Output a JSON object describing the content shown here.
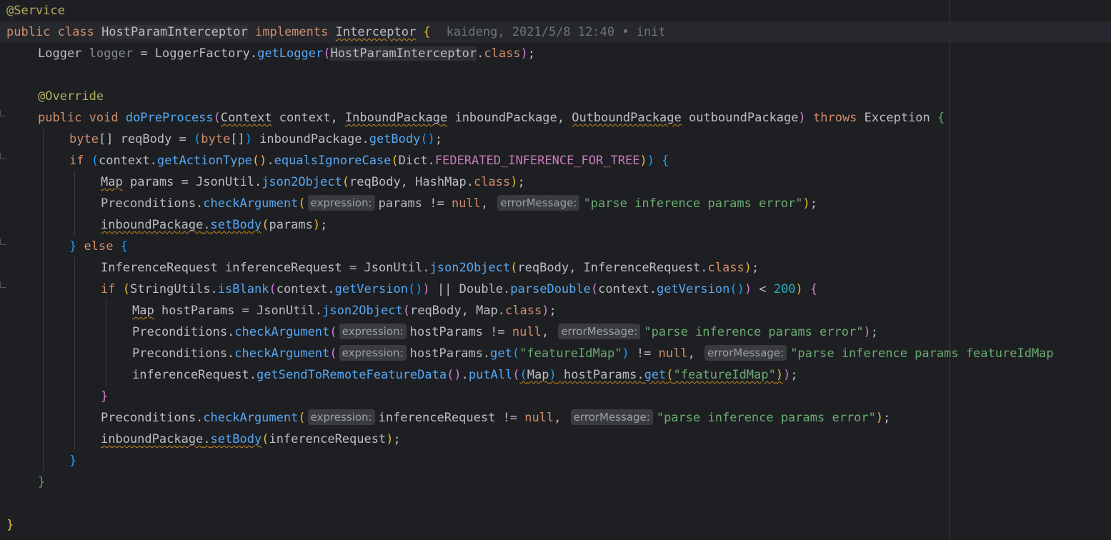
{
  "editor": {
    "lines": [
      {
        "tokens": [
          {
            "t": "@Service",
            "c": "ann"
          }
        ]
      },
      {
        "current": true,
        "tokens": [
          {
            "t": "public class ",
            "c": "kw"
          },
          {
            "t": "HostParamInterceptor",
            "c": "cls hl"
          },
          {
            "t": " implements ",
            "c": "kw"
          },
          {
            "t": "Interceptor",
            "c": "cls squig"
          },
          {
            "t": " {",
            "c": "yellow"
          }
        ],
        "blame": "kaideng, 2021/5/8 12:40 • init"
      },
      {
        "indent": 1,
        "tokens": [
          {
            "t": "Logger ",
            "c": "cls"
          },
          {
            "t": "logger",
            "c": "dim"
          },
          {
            "t": " = LoggerFactory.",
            "c": "cls"
          },
          {
            "t": "getLogger",
            "c": "fn"
          },
          {
            "t": "(",
            "c": "magenta"
          },
          {
            "t": "HostParamInterceptor",
            "c": "cls hl"
          },
          {
            "t": ".",
            "c": "cls"
          },
          {
            "t": "class",
            "c": "kw"
          },
          {
            "t": ")",
            "c": "magenta"
          },
          {
            "t": ";",
            "c": "cls"
          }
        ]
      },
      {
        "tokens": []
      },
      {
        "indent": 1,
        "tokens": [
          {
            "t": "@Override",
            "c": "ann"
          }
        ]
      },
      {
        "indent": 1,
        "fold": true,
        "tokens": [
          {
            "t": "public void ",
            "c": "kw"
          },
          {
            "t": "doPreProcess",
            "c": "fn"
          },
          {
            "t": "(",
            "c": "magenta"
          },
          {
            "t": "Context",
            "c": "cls squig"
          },
          {
            "t": " context, ",
            "c": "cls"
          },
          {
            "t": "InboundPackage",
            "c": "cls squig"
          },
          {
            "t": " inboundPackage, ",
            "c": "cls"
          },
          {
            "t": "OutboundPackage",
            "c": "cls squig"
          },
          {
            "t": " outboundPackage",
            "c": "cls"
          },
          {
            "t": ")",
            "c": "magenta"
          },
          {
            "t": " throws ",
            "c": "kw"
          },
          {
            "t": "Exception ",
            "c": "cls"
          },
          {
            "t": "{",
            "c": "green2"
          }
        ]
      },
      {
        "indent": 2,
        "tokens": [
          {
            "t": "byte",
            "c": "kw"
          },
          {
            "t": "[] reqBody = ",
            "c": "cls"
          },
          {
            "t": "(",
            "c": "blue2"
          },
          {
            "t": "byte",
            "c": "kw"
          },
          {
            "t": "[]",
            "c": "cls"
          },
          {
            "t": ")",
            "c": "blue2"
          },
          {
            "t": " inboundPackage.",
            "c": "cls"
          },
          {
            "t": "getBody",
            "c": "fn"
          },
          {
            "t": "()",
            "c": "blue2"
          },
          {
            "t": ";",
            "c": "cls"
          }
        ]
      },
      {
        "indent": 2,
        "fold": true,
        "tokens": [
          {
            "t": "if ",
            "c": "kw"
          },
          {
            "t": "(",
            "c": "blue2"
          },
          {
            "t": "context.",
            "c": "cls"
          },
          {
            "t": "getActionType",
            "c": "fn"
          },
          {
            "t": "()",
            "c": "yellow"
          },
          {
            "t": ".",
            "c": "cls"
          },
          {
            "t": "equalsIgnoreCase",
            "c": "fn"
          },
          {
            "t": "(",
            "c": "yellow"
          },
          {
            "t": "Dict.",
            "c": "cls"
          },
          {
            "t": "FEDERATED_INFERENCE_FOR_TREE",
            "c": "const"
          },
          {
            "t": ")",
            "c": "yellow"
          },
          {
            "t": ")",
            "c": "blue2"
          },
          {
            "t": " {",
            "c": "blue2"
          }
        ]
      },
      {
        "indent": 3,
        "tokens": [
          {
            "t": "Map",
            "c": "cls squig"
          },
          {
            "t": " params = JsonUtil.",
            "c": "cls"
          },
          {
            "t": "json2Object",
            "c": "fn"
          },
          {
            "t": "(",
            "c": "yellow"
          },
          {
            "t": "reqBody, HashMap.",
            "c": "cls"
          },
          {
            "t": "class",
            "c": "kw"
          },
          {
            "t": ")",
            "c": "yellow"
          },
          {
            "t": ";",
            "c": "cls"
          }
        ]
      },
      {
        "indent": 3,
        "tokens": [
          {
            "t": "Preconditions.",
            "c": "cls"
          },
          {
            "t": "checkArgument",
            "c": "fn"
          },
          {
            "t": "(",
            "c": "yellow"
          },
          {
            "hint": "expression:"
          },
          {
            "t": "params != ",
            "c": "cls"
          },
          {
            "t": "null",
            "c": "kw"
          },
          {
            "t": ", ",
            "c": "cls"
          },
          {
            "hint": "errorMessage:"
          },
          {
            "t": "\"parse inference params error\"",
            "c": "str"
          },
          {
            "t": ")",
            "c": "yellow"
          },
          {
            "t": ";",
            "c": "cls"
          }
        ]
      },
      {
        "indent": 3,
        "tokens": [
          {
            "t": "inboundPackage",
            "c": "cls squig"
          },
          {
            "t": ".",
            "c": "cls squig"
          },
          {
            "t": "setBody",
            "c": "fn squig"
          },
          {
            "t": "(",
            "c": "yellow"
          },
          {
            "t": "params",
            "c": "cls"
          },
          {
            "t": ")",
            "c": "yellow"
          },
          {
            "t": ";",
            "c": "cls"
          }
        ]
      },
      {
        "indent": 2,
        "fold": true,
        "tokens": [
          {
            "t": "}",
            "c": "blue2"
          },
          {
            "t": " else ",
            "c": "kw"
          },
          {
            "t": "{",
            "c": "blue2"
          }
        ]
      },
      {
        "indent": 3,
        "tokens": [
          {
            "t": "InferenceRequest inferenceRequest = JsonUtil.",
            "c": "cls"
          },
          {
            "t": "json2Object",
            "c": "fn"
          },
          {
            "t": "(",
            "c": "yellow"
          },
          {
            "t": "reqBody, InferenceRequest.",
            "c": "cls"
          },
          {
            "t": "class",
            "c": "kw"
          },
          {
            "t": ")",
            "c": "yellow"
          },
          {
            "t": ";",
            "c": "cls"
          }
        ]
      },
      {
        "indent": 3,
        "fold": true,
        "tokens": [
          {
            "t": "if ",
            "c": "kw"
          },
          {
            "t": "(",
            "c": "yellow"
          },
          {
            "t": "StringUtils.",
            "c": "cls"
          },
          {
            "t": "isBlank",
            "c": "fn"
          },
          {
            "t": "(",
            "c": "magenta"
          },
          {
            "t": "context.",
            "c": "cls"
          },
          {
            "t": "getVersion",
            "c": "fn"
          },
          {
            "t": "()",
            "c": "blue2"
          },
          {
            "t": ")",
            "c": "magenta"
          },
          {
            "t": " || Double.",
            "c": "cls"
          },
          {
            "t": "parseDouble",
            "c": "fn"
          },
          {
            "t": "(",
            "c": "magenta"
          },
          {
            "t": "context.",
            "c": "cls"
          },
          {
            "t": "getVersion",
            "c": "fn"
          },
          {
            "t": "()",
            "c": "blue2"
          },
          {
            "t": ")",
            "c": "magenta"
          },
          {
            "t": " < ",
            "c": "cls"
          },
          {
            "t": "200",
            "c": "num"
          },
          {
            "t": ")",
            "c": "yellow"
          },
          {
            "t": " {",
            "c": "magenta"
          }
        ]
      },
      {
        "indent": 4,
        "tokens": [
          {
            "t": "Map",
            "c": "cls squig"
          },
          {
            "t": " hostParams = JsonUtil.",
            "c": "cls"
          },
          {
            "t": "json2Object",
            "c": "fn"
          },
          {
            "t": "(",
            "c": "magenta"
          },
          {
            "t": "reqBody, Map.",
            "c": "cls"
          },
          {
            "t": "class",
            "c": "kw"
          },
          {
            "t": ")",
            "c": "magenta"
          },
          {
            "t": ";",
            "c": "cls"
          }
        ]
      },
      {
        "indent": 4,
        "tokens": [
          {
            "t": "Preconditions.",
            "c": "cls"
          },
          {
            "t": "checkArgument",
            "c": "fn"
          },
          {
            "t": "(",
            "c": "magenta"
          },
          {
            "hint": "expression:"
          },
          {
            "t": "hostParams != ",
            "c": "cls"
          },
          {
            "t": "null",
            "c": "kw"
          },
          {
            "t": ", ",
            "c": "cls"
          },
          {
            "hint": "errorMessage:"
          },
          {
            "t": "\"parse inference params error\"",
            "c": "str"
          },
          {
            "t": ")",
            "c": "magenta"
          },
          {
            "t": ";",
            "c": "cls"
          }
        ]
      },
      {
        "indent": 4,
        "tokens": [
          {
            "t": "Preconditions.",
            "c": "cls"
          },
          {
            "t": "checkArgument",
            "c": "fn"
          },
          {
            "t": "(",
            "c": "magenta"
          },
          {
            "hint": "expression:"
          },
          {
            "t": "hostParams.",
            "c": "cls"
          },
          {
            "t": "get",
            "c": "fn"
          },
          {
            "t": "(",
            "c": "blue2"
          },
          {
            "t": "\"featureIdMap\"",
            "c": "str"
          },
          {
            "t": ")",
            "c": "blue2"
          },
          {
            "t": " != ",
            "c": "cls"
          },
          {
            "t": "null",
            "c": "kw"
          },
          {
            "t": ", ",
            "c": "cls"
          },
          {
            "hint": "errorMessage:"
          },
          {
            "t": "\"parse inference params featureIdMap",
            "c": "str"
          }
        ]
      },
      {
        "indent": 4,
        "tokens": [
          {
            "t": "inferenceRequest.",
            "c": "cls"
          },
          {
            "t": "getSendToRemoteFeatureData",
            "c": "fn"
          },
          {
            "t": "()",
            "c": "magenta"
          },
          {
            "t": ".",
            "c": "cls"
          },
          {
            "t": "putAll",
            "c": "fn"
          },
          {
            "t": "(",
            "c": "magenta"
          },
          {
            "t": "(",
            "c": "blue2 squig"
          },
          {
            "t": "Map",
            "c": "cls squig"
          },
          {
            "t": ")",
            "c": "blue2 squig"
          },
          {
            "t": " hostParams.",
            "c": "cls squig"
          },
          {
            "t": "get",
            "c": "fn squig"
          },
          {
            "t": "(",
            "c": "yellow squig"
          },
          {
            "t": "\"featureIdMap\"",
            "c": "str squig"
          },
          {
            "t": ")",
            "c": "yellow squig"
          },
          {
            "t": ")",
            "c": "magenta"
          },
          {
            "t": ";",
            "c": "cls"
          }
        ]
      },
      {
        "indent": 3,
        "tokens": [
          {
            "t": "}",
            "c": "magenta"
          }
        ]
      },
      {
        "indent": 3,
        "tokens": [
          {
            "t": "Preconditions.",
            "c": "cls"
          },
          {
            "t": "checkArgument",
            "c": "fn"
          },
          {
            "t": "(",
            "c": "yellow"
          },
          {
            "hint": "expression:"
          },
          {
            "t": "inferenceRequest != ",
            "c": "cls"
          },
          {
            "t": "null",
            "c": "kw"
          },
          {
            "t": ", ",
            "c": "cls"
          },
          {
            "hint": "errorMessage:"
          },
          {
            "t": "\"parse inference params error\"",
            "c": "str"
          },
          {
            "t": ")",
            "c": "yellow"
          },
          {
            "t": ";",
            "c": "cls"
          }
        ]
      },
      {
        "indent": 3,
        "tokens": [
          {
            "t": "inboundPackage",
            "c": "cls squig"
          },
          {
            "t": ".",
            "c": "cls squig"
          },
          {
            "t": "setBody",
            "c": "fn squig"
          },
          {
            "t": "(",
            "c": "yellow"
          },
          {
            "t": "inferenceRequest",
            "c": "cls"
          },
          {
            "t": ")",
            "c": "yellow"
          },
          {
            "t": ";",
            "c": "cls"
          }
        ]
      },
      {
        "indent": 2,
        "tokens": [
          {
            "t": "}",
            "c": "blue2"
          }
        ]
      },
      {
        "indent": 1,
        "tokens": [
          {
            "t": "}",
            "c": "green2"
          }
        ]
      },
      {
        "tokens": []
      },
      {
        "tokens": [
          {
            "t": "}",
            "c": "yellow"
          }
        ]
      }
    ]
  }
}
